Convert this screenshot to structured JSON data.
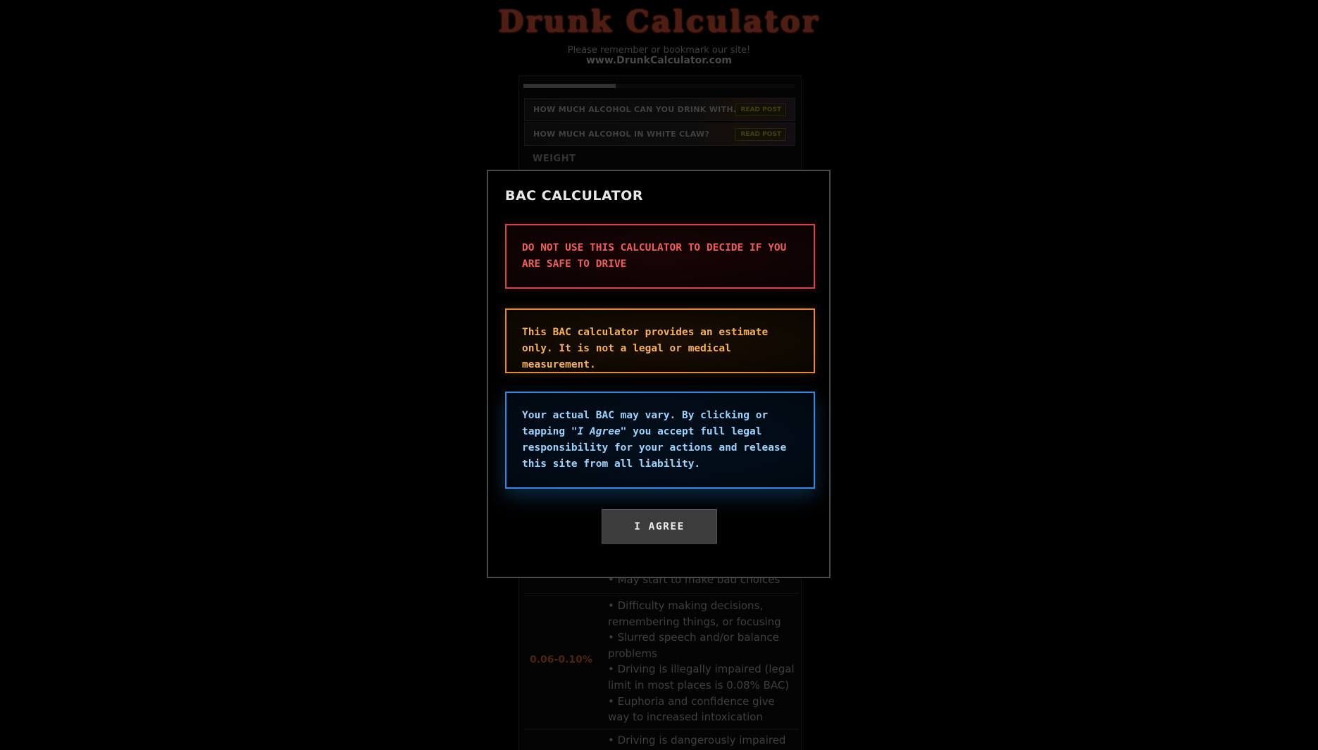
{
  "site": {
    "title": "Drunk Calculator",
    "bookmark_note": "Please remember or bookmark our site!",
    "url": "www.DrunkCalculator.com",
    "progress_fraction": 0.34
  },
  "posts": [
    {
      "title": "HOW MUCH ALCOHOL CAN YOU DRINK WITH...",
      "button": "READ POST"
    },
    {
      "title": "HOW MUCH ALCOHOL IN WHITE CLAW?",
      "button": "READ POST"
    }
  ],
  "form": {
    "weight_label": "WEIGHT"
  },
  "bac_table": {
    "partial_effect_top": "• May start to make bad choices",
    "rows": [
      {
        "range": "0.06-0.10%",
        "effects": [
          "• Difficulty making decisions, remembering things, or focusing",
          "• Slurred speech and/or balance problems",
          "• Driving is illegally impaired (legal limit in most places is 0.08% BAC)",
          "• Euphoria and confidence give way to increased intoxication"
        ]
      },
      {
        "range": "",
        "effects": [
          "• Driving is dangerously impaired"
        ]
      }
    ]
  },
  "modal": {
    "title": "BAC CALCULATOR",
    "warning_red": "DO NOT USE THIS CALCULATOR TO DECIDE IF YOU ARE SAFE TO DRIVE",
    "warning_orange": "This BAC calculator provides an estimate only. It is not a legal or medical measurement.",
    "notice_blue_before": "Your actual BAC may vary. By clicking or tapping ",
    "notice_blue_emph": "\"I Agree\"",
    "notice_blue_after": " you accept full legal responsibility for your actions and release this site from all liability.",
    "agree_label": "I AGREE"
  },
  "colors": {
    "warning_red": "#d8424a",
    "warning_orange": "#e58b2c",
    "notice_blue": "#2f8ae6",
    "button_bg": "#3c3c3c"
  }
}
